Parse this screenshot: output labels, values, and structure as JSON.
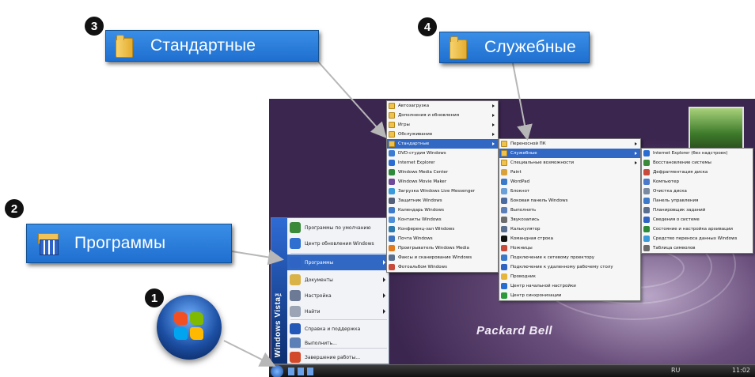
{
  "callouts": {
    "c1": {
      "number": "1"
    },
    "c2": {
      "number": "2",
      "label": "Программы"
    },
    "c3": {
      "number": "3",
      "label": "Стандартные"
    },
    "c4": {
      "number": "4",
      "label": "Служебные"
    }
  },
  "desktop": {
    "brand": "Packard Bell",
    "sidebar_text": "Windows Vista™",
    "tray_lang": "RU",
    "tray_time": "11:02"
  },
  "start_menu": {
    "items": [
      {
        "label": "Программы по умолчанию",
        "icon": "default-programs-icon",
        "color": "#3a8a3a"
      },
      {
        "label": "Центр обновления Windows",
        "icon": "windows-update-icon",
        "color": "#2e6fcf"
      },
      {
        "label": "Программы",
        "icon": "programs-icon",
        "color": "#2f63c4",
        "submenu": true,
        "selected": true
      },
      {
        "label": "Документы",
        "icon": "documents-icon",
        "color": "#d9b348",
        "submenu": true
      },
      {
        "label": "Настройка",
        "icon": "settings-icon",
        "color": "#6c7a96",
        "submenu": true
      },
      {
        "label": "Найти",
        "icon": "search-icon",
        "color": "#9aa4b5",
        "submenu": true
      },
      {
        "label": "Справка и поддержка",
        "icon": "help-icon",
        "color": "#2357b8"
      },
      {
        "label": "Выполнить...",
        "icon": "run-icon",
        "color": "#5d7fb8"
      },
      {
        "label": "Завершение работы...",
        "icon": "shutdown-icon",
        "color": "#d24a2a"
      }
    ]
  },
  "programs_menu": {
    "items": [
      {
        "label": "Автозагрузка",
        "folder": true,
        "submenu": true
      },
      {
        "label": "Дополнения и обновления",
        "folder": true,
        "submenu": true
      },
      {
        "label": "Игры",
        "folder": true,
        "submenu": true
      },
      {
        "label": "Обслуживание",
        "folder": true,
        "submenu": true
      },
      {
        "label": "Стандартные",
        "folder": true,
        "submenu": true,
        "selected": true
      },
      {
        "label": "DVD-студия Windows",
        "color": "#3b7bd1"
      },
      {
        "label": "Internet Explorer",
        "color": "#2a6dd2"
      },
      {
        "label": "Windows Media Center",
        "color": "#2c8a3a"
      },
      {
        "label": "Windows Movie Maker",
        "color": "#6f4a9a"
      },
      {
        "label": "Загрузка Windows Live Messenger",
        "color": "#3b9ad9"
      },
      {
        "label": "Защитник Windows",
        "color": "#52607a"
      },
      {
        "label": "Календарь Windows",
        "color": "#3d7ac9"
      },
      {
        "label": "Контакты Windows",
        "color": "#4d8fd8"
      },
      {
        "label": "Конференц-зал Windows",
        "color": "#2c7ab0"
      },
      {
        "label": "Почта Windows",
        "color": "#3c74c2"
      },
      {
        "label": "Проигрыватель Windows Media",
        "color": "#e07a1c"
      },
      {
        "label": "Факсы и сканирование Windows",
        "color": "#5a6f8f"
      },
      {
        "label": "Фотоальбом Windows",
        "color": "#c84a3a"
      }
    ]
  },
  "accessories_menu": {
    "items": [
      {
        "label": "Переносной ПК",
        "folder": true,
        "submenu": true
      },
      {
        "label": "Служебные",
        "folder": true,
        "submenu": true,
        "selected": true
      },
      {
        "label": "Специальные возможности",
        "folder": true,
        "submenu": true
      },
      {
        "label": "Paint",
        "color": "#d9a13a"
      },
      {
        "label": "WordPad",
        "color": "#3a78c9"
      },
      {
        "label": "Блокнот",
        "color": "#6a9fd8"
      },
      {
        "label": "Боковая панель Windows",
        "color": "#4a6aa0"
      },
      {
        "label": "Выполнить",
        "color": "#5d7fb8"
      },
      {
        "label": "Звукозапись",
        "color": "#6d6d6d"
      },
      {
        "label": "Калькулятор",
        "color": "#5a6f8f"
      },
      {
        "label": "Командная строка",
        "color": "#111111"
      },
      {
        "label": "Ножницы",
        "color": "#c84a3a"
      },
      {
        "label": "Подключение к сетевому проектору",
        "color": "#3a78c9"
      },
      {
        "label": "Подключение к удаленному рабочему столу",
        "color": "#2f63c4"
      },
      {
        "label": "Проводник",
        "color": "#e6b53c"
      },
      {
        "label": "Центр начальной настройки",
        "color": "#2a6dd2"
      },
      {
        "label": "Центр синхронизации",
        "color": "#2c9a3a"
      }
    ]
  },
  "system_tools_menu": {
    "items": [
      {
        "label": "Internet Explorer (без надстроек)",
        "color": "#2a6dd2"
      },
      {
        "label": "Восстановление системы",
        "color": "#3a8a3a"
      },
      {
        "label": "Дефрагментация диска",
        "color": "#c84a3a"
      },
      {
        "label": "Компьютер",
        "color": "#4a7ac9"
      },
      {
        "label": "Очистка диска",
        "color": "#7a8aa0"
      },
      {
        "label": "Панель управления",
        "color": "#3d7ac9"
      },
      {
        "label": "Планировщик заданий",
        "color": "#5a6f8f"
      },
      {
        "label": "Сведения о системе",
        "color": "#2f63c4"
      },
      {
        "label": "Состояние и настройка архивации",
        "color": "#2c8a3a"
      },
      {
        "label": "Средство переноса данных Windows",
        "color": "#3a9ad9"
      },
      {
        "label": "Таблица символов",
        "color": "#6a6a6a"
      }
    ]
  }
}
